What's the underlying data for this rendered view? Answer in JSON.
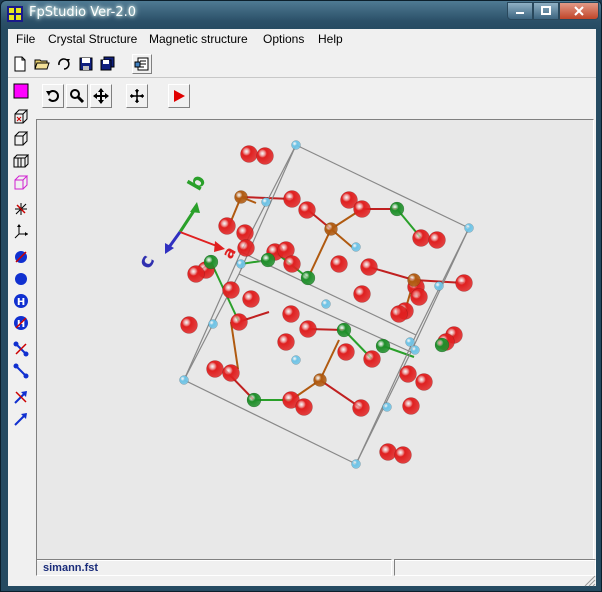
{
  "window": {
    "title": "FpStudio Ver-2.0"
  },
  "menu": [
    "File",
    "Crystal Structure",
    "Magnetic structure",
    "Options",
    "Help"
  ],
  "toolbar": {
    "buttons": [
      "new-file-icon",
      "open-folder-icon",
      "reload-icon",
      "save-icon",
      "save-all-icon",
      "properties-icon"
    ]
  },
  "left_tools": [
    "color-swatch-icon",
    "cell-box-icon",
    "cell-single-icon",
    "cell-multi-icon",
    "cell-outline-icon",
    "axes-remove-icon",
    "axes-icon",
    "atom-crossed-icon",
    "atom-icon",
    "hydrogen-atom-icon",
    "hydrogen-crossed-icon",
    "bond-crossed-icon",
    "bond-icon",
    "vector-crossed-icon",
    "vector-icon"
  ],
  "view_tools": [
    "rotate-icon",
    "zoom-icon",
    "pan-icon",
    "fit-icon",
    "play-icon"
  ],
  "axes": {
    "a": "a",
    "b": "b",
    "c": "c"
  },
  "colors": {
    "oxygen": "#e02020",
    "metal_brown": "#b05a10",
    "metal_green": "#1f8f2a",
    "small_blue": "#6ec3e6",
    "cell_line": "#888888"
  },
  "status": {
    "file": "simann.fst"
  }
}
